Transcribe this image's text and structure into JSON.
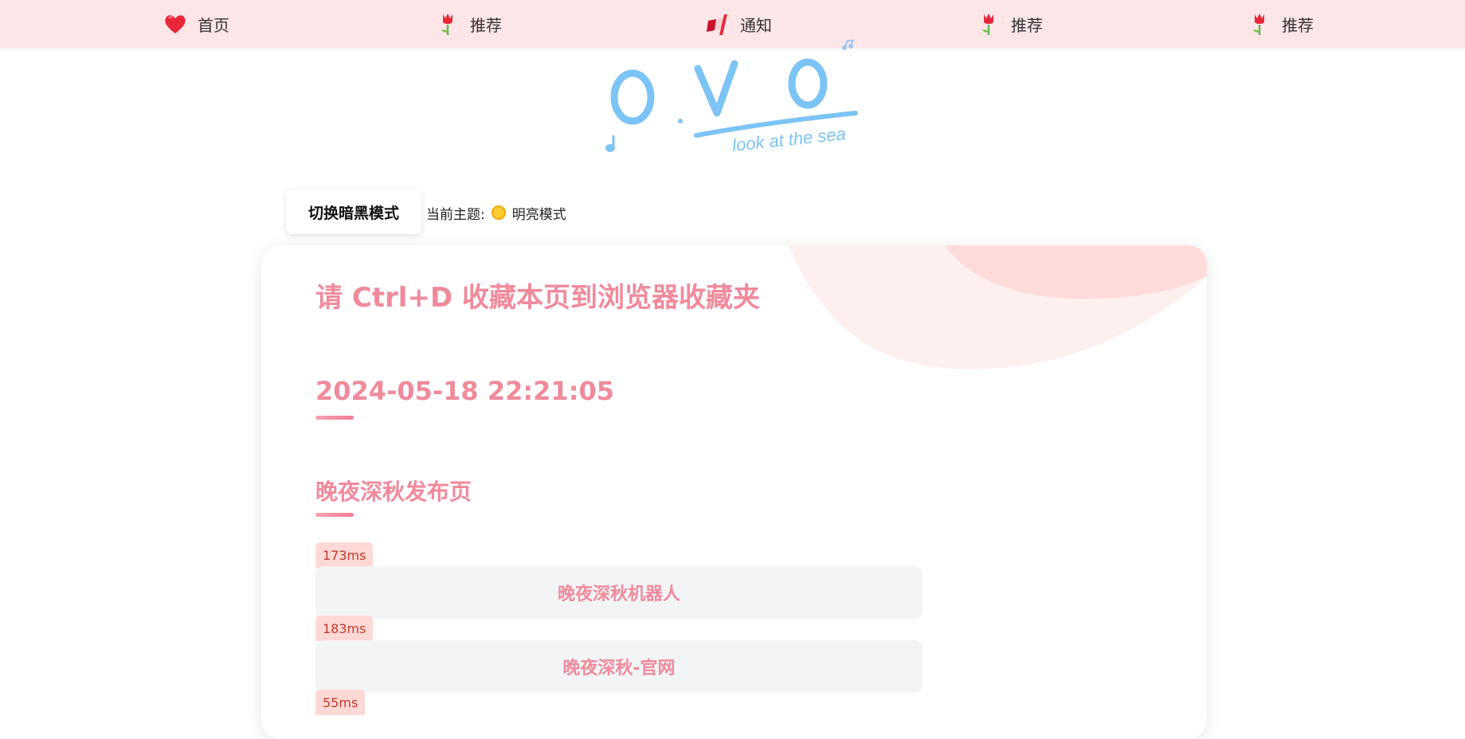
{
  "nav": {
    "items": [
      {
        "label": "首页",
        "icon": "heart-icon"
      },
      {
        "label": "推荐",
        "icon": "tulip-icon"
      },
      {
        "label": "通知",
        "icon": "flag-icon"
      },
      {
        "label": "推荐",
        "icon": "tulip-icon"
      },
      {
        "label": "推荐",
        "icon": "tulip-icon"
      }
    ]
  },
  "logo": {
    "text": "O . V O",
    "tagline": "look at the sea"
  },
  "theme": {
    "toggle_label": "切换暗黑模式",
    "current_label": "当前主题:",
    "current_value": "明亮模式",
    "icon": "sun-icon"
  },
  "card": {
    "headline": "请 Ctrl+D 收藏本页到浏览器收藏夹",
    "datetime": "2024-05-18 22:21:05",
    "section_title": "晚夜深秋发布页",
    "links": [
      {
        "latency": "173ms",
        "label": "晚夜深秋机器人"
      },
      {
        "latency": "183ms",
        "label": "晚夜深秋-官网"
      },
      {
        "latency": "55ms",
        "label": ""
      }
    ]
  },
  "colors": {
    "accent": "#f08a9b",
    "nav_bg": "#fce6e8",
    "logo_blue": "#7cc4f5",
    "badge_bg": "#ffd9d6"
  }
}
